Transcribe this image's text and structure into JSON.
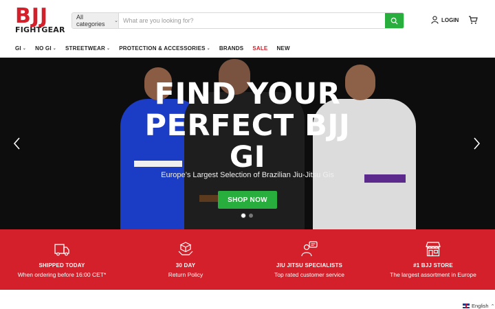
{
  "brand": {
    "logo_top": "BJJ",
    "logo_bottom": "FIGHTGEAR",
    "color": "#d4202a"
  },
  "search": {
    "category": "All categories",
    "placeholder": "What are you looking for?",
    "button_color": "#27ae3c"
  },
  "account": {
    "login_label": "LOGIN"
  },
  "nav": {
    "items": [
      {
        "label": "GI",
        "dropdown": true
      },
      {
        "label": "NO GI",
        "dropdown": true
      },
      {
        "label": "STREETWEAR",
        "dropdown": true
      },
      {
        "label": "PROTECTION & ACCESSORIES",
        "dropdown": true
      },
      {
        "label": "BRANDS",
        "dropdown": false
      },
      {
        "label": "SALE",
        "dropdown": false
      },
      {
        "label": "NEW",
        "dropdown": false
      }
    ]
  },
  "hero": {
    "title": "FIND YOUR PERFECT BJJ GI",
    "subtitle": "Europe’s Largest Selection of Brazilian Jiu-Jitsu Gis",
    "cta": "SHOP NOW",
    "slides": 2,
    "active_slide": 1
  },
  "features": [
    {
      "icon": "truck-icon",
      "title": "SHIPPED TODAY",
      "text": "When ordering before 16:00 CET*"
    },
    {
      "icon": "box-hand-icon",
      "title": "30 DAY",
      "text": "Return Policy"
    },
    {
      "icon": "specialist-icon",
      "title": "JIU JITSU SPECIALISTS",
      "text": "Top rated customer service"
    },
    {
      "icon": "store-icon",
      "title": "#1 BJJ STORE",
      "text": "The largest assortment in Europe"
    }
  ],
  "language": {
    "label": "English"
  }
}
